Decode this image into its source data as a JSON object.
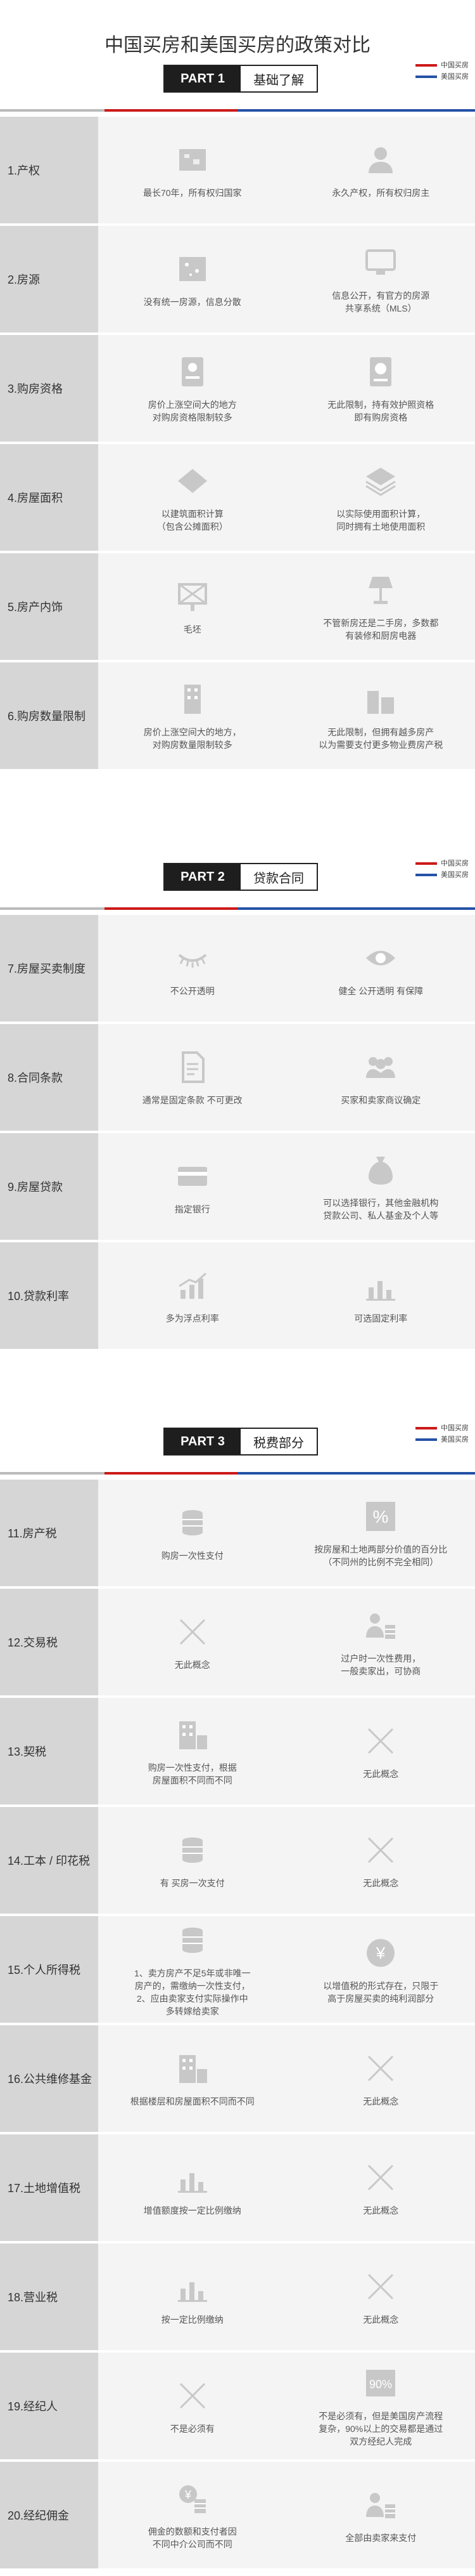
{
  "title": "中国买房和美国买房的政策对比",
  "legend": {
    "china": "中国买房",
    "usa": "美国买房",
    "china_color": "#cc1a1a",
    "usa_color": "#2452a6"
  },
  "parts": [
    {
      "no": "PART 1",
      "name": "基础了解",
      "rows": [
        {
          "label": "1.产权",
          "china": "最长70年，所有权归国家",
          "usa": "永久产权，所有权归房主",
          "china_icon": "map-icon",
          "usa_icon": "person-icon"
        },
        {
          "label": "2.房源",
          "china": "没有统一房源，信息分散",
          "usa": "信息公开，有官方的房源\n共享系统（MLS）",
          "china_icon": "scatter-icon",
          "usa_icon": "monitor-icon"
        },
        {
          "label": "3.购房资格",
          "china": "房价上涨空间大的地方\n对购房资格限制较多",
          "usa": "无此限制，持有效护照资格\n即有购房资格",
          "china_icon": "id-card-icon",
          "usa_icon": "passport-icon"
        },
        {
          "label": "4.房屋面积",
          "china": "以建筑面积计算\n（包含公摊面积）",
          "usa": "以实际使用面积计算，\n同时拥有土地使用面积",
          "china_icon": "diamond-icon",
          "usa_icon": "layers-icon"
        },
        {
          "label": "5.房产内饰",
          "china": "毛坯",
          "usa": "不管新房还是二手房，多数都\n有装修和厨房电器",
          "china_icon": "unfinished-icon",
          "usa_icon": "lamp-icon"
        },
        {
          "label": "6.购房数量限制",
          "china": "房价上涨空间大的地方，\n对购房数量限制较多",
          "usa": "无此限制，但拥有越多房产\n以为需要支付更多物业费房产税",
          "china_icon": "building-icon",
          "usa_icon": "buildings-icon"
        }
      ]
    },
    {
      "no": "PART 2",
      "name": "贷款合同",
      "rows": [
        {
          "label": "7.房屋买卖制度",
          "china": "不公开透明",
          "usa": "健全  公开透明  有保障",
          "china_icon": "closed-eye-icon",
          "usa_icon": "eye-icon"
        },
        {
          "label": "8.合同条款",
          "china": "通常是固定条款  不可更改",
          "usa": "买家和卖家商议确定",
          "china_icon": "document-icon",
          "usa_icon": "people-icon"
        },
        {
          "label": "9.房屋贷款",
          "china": "指定银行",
          "usa": "可以选择银行，其他金融机构\n贷款公司、私人基金及个人等",
          "china_icon": "card-icon",
          "usa_icon": "money-bag-icon"
        },
        {
          "label": "10.贷款利率",
          "china": "多为浮点利率",
          "usa": "可选固定利率",
          "china_icon": "rising-bars-icon",
          "usa_icon": "bars-icon"
        }
      ]
    },
    {
      "no": "PART 3",
      "name": "税费部分",
      "rows": [
        {
          "label": "11.房产税",
          "china": "购房一次性支付",
          "usa": "按房屋和土地两部分价值的百分比\n（不同州的比例不完全相同）",
          "china_icon": "coins-icon",
          "usa_icon": "percent-icon"
        },
        {
          "label": "12.交易税",
          "china": "无此概念",
          "usa": "过户时一次性费用，\n一般卖家出，可协商",
          "china_icon": "cross-icon",
          "usa_icon": "person-coins-icon"
        },
        {
          "label": "13.契税",
          "china": "购房一次性支付，根据\n房屋面积不同而不同",
          "usa": "无此概念",
          "china_icon": "building-coins-icon",
          "usa_icon": "cross-icon"
        },
        {
          "label": "14.工本 / 印花税",
          "china": "有  买房一次支付",
          "usa": "无此概念",
          "china_icon": "coins-icon",
          "usa_icon": "cross-icon"
        },
        {
          "label": "15.个人所得税",
          "china": "1、卖方房产不足5年或非唯一\n房产的，需缴纳一次性支付，\n2、应由卖家支付实际操作中\n多转嫁给卖家",
          "usa": "以增值税的形式存在，只限于\n高于房屋买卖的纯利润部分",
          "china_icon": "coins-icon",
          "usa_icon": "yen-icon"
        },
        {
          "label": "16.公共维修基金",
          "china": "根据楼层和房屋面积不同而不同",
          "usa": "无此概念",
          "china_icon": "building-coins-icon",
          "usa_icon": "cross-icon"
        },
        {
          "label": "17.土地增值税",
          "china": "增值额度按一定比例缴纳",
          "usa": "无此概念",
          "china_icon": "bars-icon",
          "usa_icon": "cross-icon"
        },
        {
          "label": "18.营业税",
          "china": "按一定比例缴纳",
          "usa": "无此概念",
          "china_icon": "bars-icon",
          "usa_icon": "cross-icon"
        },
        {
          "label": "19.经纪人",
          "china": "不是必须有",
          "usa": "不是必须有，但是美国房产流程\n复杂，90%以上的交易都是通过\n双方经纪人完成",
          "china_icon": "cross-icon",
          "usa_icon": "ninety-percent-icon"
        },
        {
          "label": "20.经纪佣金",
          "china": "佣金的数额和支付者因\n不同中介公司而不同",
          "usa": "全部由卖家来支付",
          "china_icon": "yen-coins-icon",
          "usa_icon": "person-coins-icon"
        }
      ]
    }
  ]
}
